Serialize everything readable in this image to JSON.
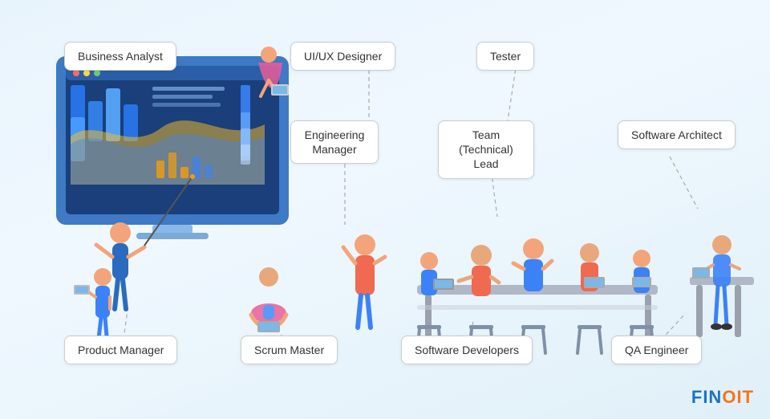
{
  "roles": {
    "business_analyst": "Business Analyst",
    "ui_ux_designer": "UI/UX Designer",
    "tester": "Tester",
    "engineering_manager": "Engineering\nManager",
    "tech_lead": "Team (Technical) Lead",
    "software_architect": "Software Architect",
    "product_manager": "Product Manager",
    "scrum_master": "Scrum Master",
    "software_developers": "Software Developers",
    "qa_engineer": "QA Engineer"
  },
  "logo": {
    "text_fin": "FIN",
    "text_oit": "OIT"
  }
}
